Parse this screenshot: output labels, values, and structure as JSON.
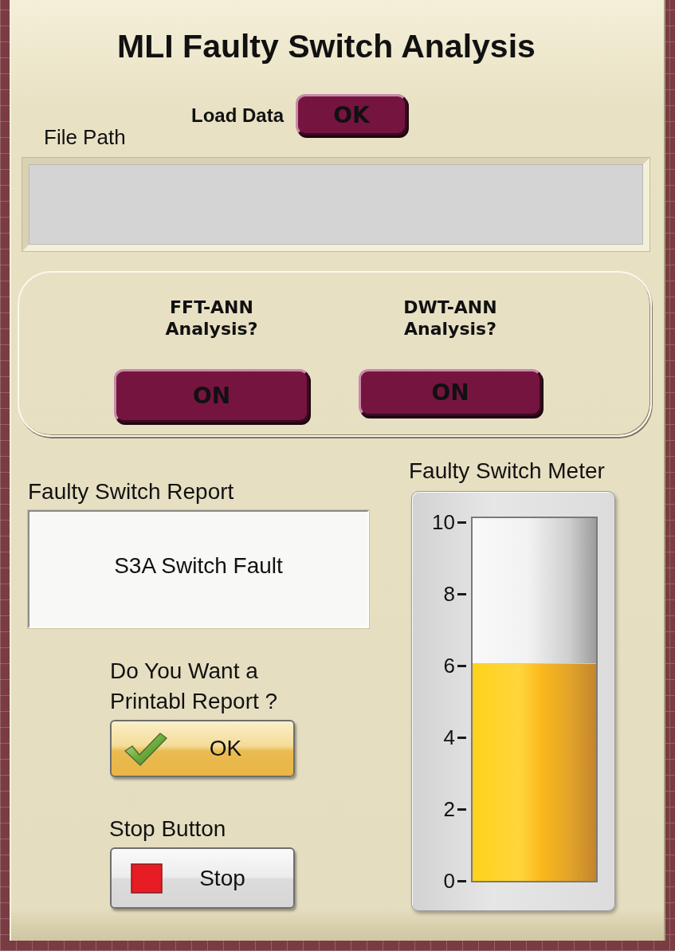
{
  "window": {
    "title": "MLI Faulty Switch Analysis"
  },
  "load_data": {
    "label": "Load Data",
    "button": "OK"
  },
  "file_path": {
    "label": "File Path"
  },
  "analysis": [
    {
      "label": [
        "FFT-ANN",
        "Analysis?"
      ],
      "button": "ON"
    },
    {
      "label": [
        "DWT-ANN",
        "Analysis?"
      ],
      "button": "ON"
    }
  ],
  "report": {
    "label": "Faulty Switch Report",
    "value": "S3A Switch Fault"
  },
  "printable_report": {
    "question": [
      "Do You Want a",
      "Printabl Report ?"
    ],
    "button": "OK"
  },
  "stop": {
    "label": "Stop Button",
    "button": "Stop"
  },
  "meter": {
    "label": "Faulty Switch Meter",
    "scale": [
      "10",
      "8",
      "6",
      "4",
      "2",
      "0"
    ],
    "level": 0.6
  }
}
